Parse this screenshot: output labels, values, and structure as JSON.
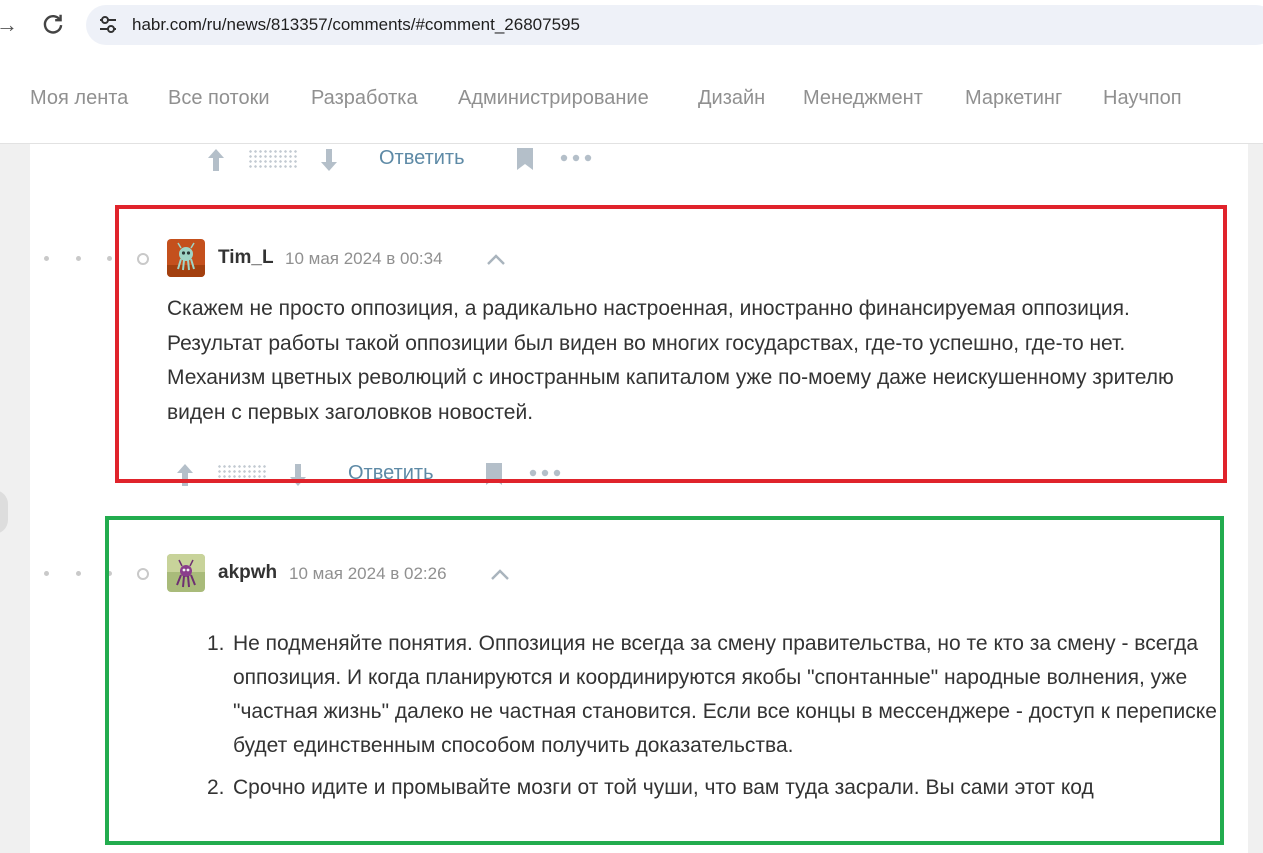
{
  "browser": {
    "url": "habr.com/ru/news/813357/comments/#comment_26807595",
    "forward_glyph": "→"
  },
  "site_nav": {
    "items": [
      "Моя лента",
      "Все потоки",
      "Разработка",
      "Администрирование",
      "Дизайн",
      "Менеджмент",
      "Маркетинг",
      "Научпоп"
    ]
  },
  "actions": {
    "reply_label": "Ответить"
  },
  "comments": [
    {
      "author": "Tim_L",
      "timestamp": "10 мая 2024 в 00:34",
      "text": "Скажем не просто оппозиция, а радикально настроенная, иностранно финансируемая оппозиция. Результат работы такой оппозиции был виден во многих государствах, где-то успешно, где-то нет. Механизм цветных революций с иностранным капиталом уже по-моему даже неискушенному зрителю виден с первых заголовков новостей."
    },
    {
      "author": "akpwh",
      "timestamp": "10 мая 2024 в 02:26",
      "list": [
        {
          "num": "1.",
          "text": "Не подменяйте понятия. Оппозиция не всегда за смену правительства, но те кто за смену - всегда оппозиция. И когда планируются и координируются якобы \"спонтанные\" народные волнения, уже \"частная жизнь\" далеко не частная становится. Если все концы в мессенджере - доступ к переписке будет единственным способом получить доказательства."
        },
        {
          "num": "2.",
          "text": "Срочно идите и промывайте мозги от той чуши, что вам туда засрали. Вы сами этот код"
        }
      ]
    }
  ],
  "colors": {
    "highlight_red": "#e0232b",
    "highlight_green": "#22ac4e",
    "reply_link": "#5e8aa6"
  }
}
